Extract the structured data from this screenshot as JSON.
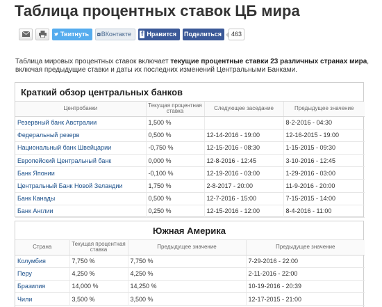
{
  "page": {
    "title": "Таблица процентных ставок ЦБ мира"
  },
  "share": {
    "twitter_label": "Твитнуть",
    "vk_label": "ВКонтакте",
    "facebook_label": "Нравится",
    "share_label": "Поделиться",
    "count": "463",
    "brand_colors": {
      "twitter": "#55acee",
      "facebook": "#3b5998"
    },
    "icons": [
      "mail-icon",
      "print-icon",
      "twitter-bird-icon",
      "vk-icon",
      "facebook-icon"
    ]
  },
  "intro": {
    "part1": "Таблица мировых процентных ставок включает ",
    "bold": "текущие процентные ставки 23 различных странах мира",
    "part2": ", включая предыдущие ставки и даты их последних изменений Центральными Банками."
  },
  "central_banks": {
    "heading": "Краткий обзор центральных банков",
    "columns": [
      "Центробанки",
      "Текущая процентная ставка",
      "Следующее заседание",
      "Предыдущее значение"
    ],
    "rows": [
      [
        "Резервный банк Австралии",
        "1,500 %",
        "",
        "8-2-2016 - 04:30"
      ],
      [
        "Федеральный резерв",
        "0,500 %",
        "12-14-2016 - 19:00",
        "12-16-2015 - 19:00"
      ],
      [
        "Национальный банк Швейцарии",
        "-0,750 %",
        "12-15-2016 - 08:30",
        "1-15-2015 - 09:30"
      ],
      [
        "Европейский Центральный банк",
        "0,000 %",
        "12-8-2016 - 12:45",
        "3-10-2016 - 12:45"
      ],
      [
        "Банк Японии",
        "-0,100 %",
        "12-19-2016 - 03:00",
        "1-29-2016 - 03:00"
      ],
      [
        "Центральный Банк Новой Зеландии",
        "1,750 %",
        "2-8-2017 - 20:00",
        "11-9-2016 - 20:00"
      ],
      [
        "Банк Канады",
        "0,500 %",
        "12-7-2016 - 15:00",
        "7-15-2015 - 14:00"
      ],
      [
        "Банк Англии",
        "0,250 %",
        "12-15-2016 - 12:00",
        "8-4-2016 - 11:00"
      ]
    ]
  },
  "south_america": {
    "heading": "Южная Америка",
    "columns": [
      "Страна",
      "Текущая процентная ставка",
      "Предыдущее значение",
      "Предыдущее значение"
    ],
    "rows": [
      [
        "Колумбия",
        "7,750 %",
        "7,750 %",
        "7-29-2016 - 22:00"
      ],
      [
        "Перу",
        "4,250 %",
        "4,250 %",
        "2-11-2016 - 22:00"
      ],
      [
        "Бразилия",
        "14,000 %",
        "14,250 %",
        "10-19-2016 - 20:39"
      ],
      [
        "Чили",
        "3,500 %",
        "3,500 %",
        "12-17-2015 - 21:00"
      ]
    ]
  }
}
